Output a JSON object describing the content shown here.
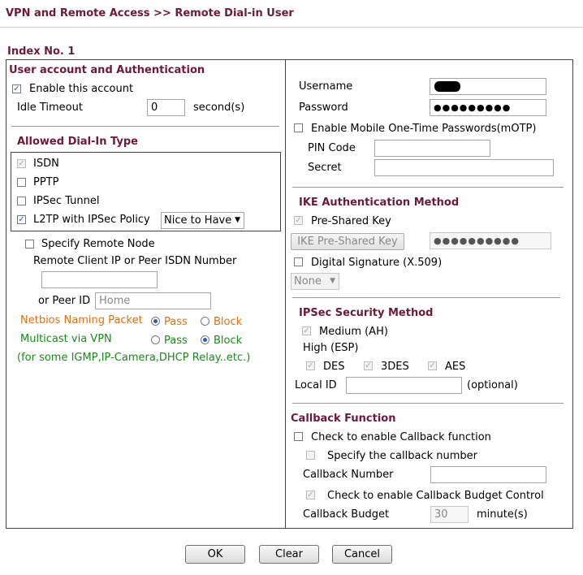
{
  "page_title": "VPN and Remote Access >> Remote Dial-in User",
  "index_label": "Index No. 1",
  "left": {
    "section_title": "User account and Authentication",
    "enable_account": {
      "label": "Enable this account",
      "checked": true
    },
    "idle_timeout": {
      "label": "Idle Timeout",
      "value": "0",
      "unit": "second(s)"
    },
    "dial_in_title": "Allowed Dial-In Type",
    "dial_in_types": {
      "isdn": {
        "label": "ISDN",
        "checked": true,
        "disabled": true
      },
      "pptp": {
        "label": "PPTP",
        "checked": false
      },
      "ipsec_tunnel": {
        "label": "IPSec Tunnel",
        "checked": false
      },
      "l2tp": {
        "label": "L2TP with IPSec Policy",
        "checked": true,
        "policy": "Nice to Have"
      }
    },
    "specify_remote_node": {
      "label": "Specify Remote Node",
      "checked": false
    },
    "remote_client_label": "Remote Client IP or Peer ISDN Number",
    "remote_client_value": "",
    "peer_id_label": "or Peer ID",
    "peer_id_placeholder": "Home",
    "netbios": {
      "label": "Netbios Naming Packet",
      "pass": "Pass",
      "block": "Block",
      "selected": "Pass"
    },
    "multicast": {
      "label": "Multicast via VPN",
      "pass": "Pass",
      "block": "Block",
      "selected": "Block"
    },
    "multicast_note": "(for some IGMP,IP-Camera,DHCP Relay..etc.)"
  },
  "right": {
    "username_label": "Username",
    "password_label": "Password",
    "password_value": "●●●●●●●●●",
    "motp": {
      "label": "Enable Mobile One-Time Passwords(mOTP)",
      "checked": false
    },
    "pin_code_label": "PIN Code",
    "secret_label": "Secret",
    "ike_title": "IKE Authentication Method",
    "pre_shared_key": {
      "label": "Pre-Shared Key",
      "checked": true
    },
    "ike_psk_button": "IKE Pre-Shared Key",
    "ike_psk_value": "●●●●●●●●●●",
    "digital_signature": {
      "label": "Digital Signature (X.509)",
      "checked": false
    },
    "cert_select": "None",
    "ipsec_title": "IPSec Security Method",
    "medium_ah": {
      "label": "Medium (AH)",
      "checked": true
    },
    "high_esp_label": "High (ESP)",
    "des": {
      "label": "DES",
      "checked": true
    },
    "tdes": {
      "label": "3DES",
      "checked": true
    },
    "aes": {
      "label": "AES",
      "checked": true
    },
    "local_id_label": "Local ID",
    "local_id_optional": "(optional)",
    "callback_title": "Callback Function",
    "callback_enable": {
      "label": "Check to enable Callback function",
      "checked": false
    },
    "callback_specify": {
      "label": "Specify the callback number",
      "checked": false
    },
    "callback_number_label": "Callback Number",
    "callback_budget_ctrl": {
      "label": "Check to enable Callback Budget Control",
      "checked": true
    },
    "callback_budget_label": "Callback Budget",
    "callback_budget_value": "30",
    "callback_budget_unit": "minute(s)"
  },
  "buttons": {
    "ok": "OK",
    "clear": "Clear",
    "cancel": "Cancel"
  },
  "colors": {
    "header": "#6b1a3a",
    "orange": "#e07010",
    "green": "#1a8a1a",
    "accent": "#2a5ea8"
  }
}
